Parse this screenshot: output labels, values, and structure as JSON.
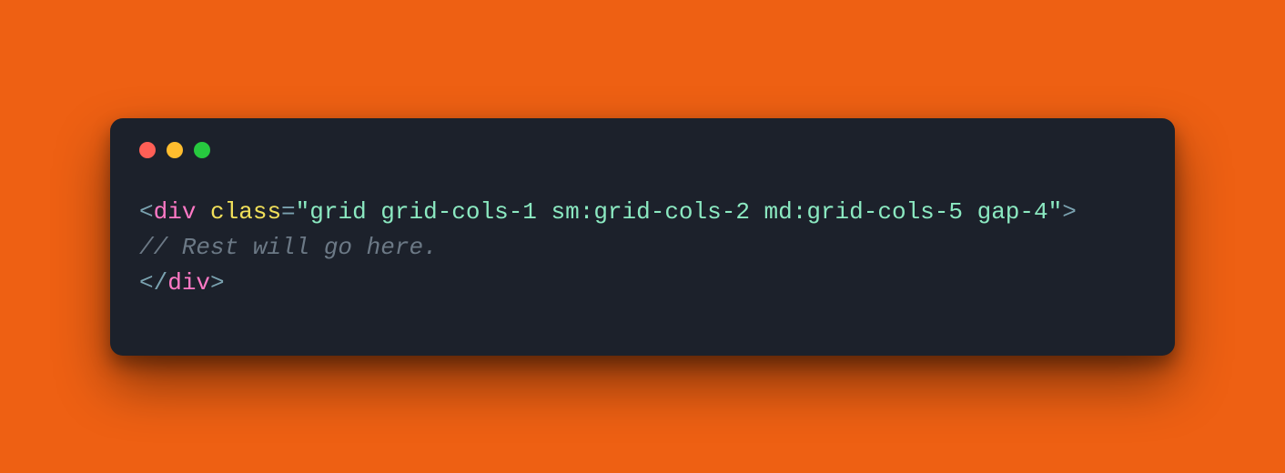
{
  "code": {
    "line1": {
      "open_angle": "<",
      "tag": "div",
      "space1": " ",
      "attr": "class",
      "eq": "=",
      "q1": "\"",
      "class_value": "grid grid-cols-1 sm:grid-cols-2 md:grid-cols-5 gap-4",
      "q2": "\"",
      "close_angle": ">"
    },
    "line2": {
      "comment": "// Rest will go here."
    },
    "line3": {
      "open": "</",
      "tag": "div",
      "close": ">"
    }
  },
  "traffic_lights": [
    "red",
    "yellow",
    "green"
  ]
}
